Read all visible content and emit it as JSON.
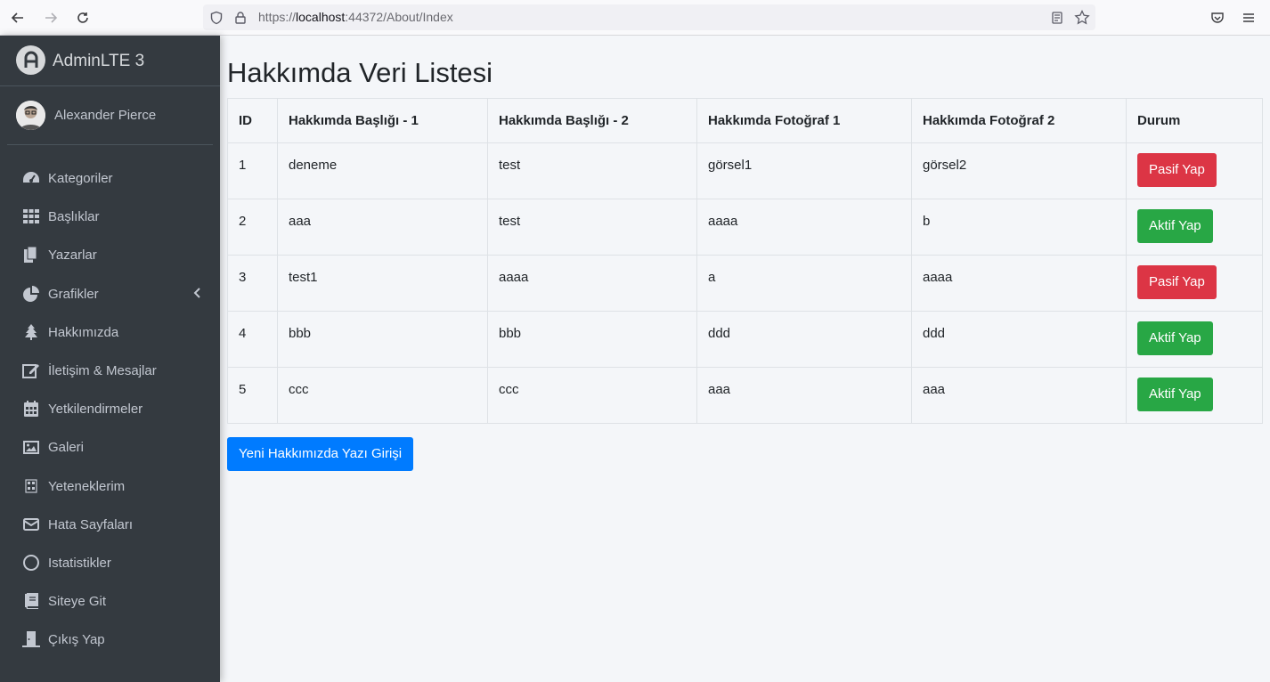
{
  "browser": {
    "url_prefix": "https://",
    "url_host": "localhost",
    "url_rest": ":44372/About/Index"
  },
  "sidebar": {
    "brand": "AdminLTE 3",
    "user": "Alexander Pierce",
    "items": [
      {
        "label": "Kategoriler",
        "icon": "dashboard-gauge-icon"
      },
      {
        "label": "Başlıklar",
        "icon": "grid-icon"
      },
      {
        "label": "Yazarlar",
        "icon": "copy-icon"
      },
      {
        "label": "Grafikler",
        "icon": "pie-chart-icon"
      },
      {
        "label": "Hakkımızda",
        "icon": "tree-icon"
      },
      {
        "label": "İletişim & Mesajlar",
        "icon": "edit-icon"
      },
      {
        "label": "Yetkilendirmeler",
        "icon": "calendar-icon"
      },
      {
        "label": "Galeri",
        "icon": "image-icon"
      },
      {
        "label": "Yeteneklerim",
        "icon": "keyboard-icon"
      },
      {
        "label": "Hata Sayfaları",
        "icon": "envelope-icon"
      },
      {
        "label": "Istatistikler",
        "icon": "circle-icon"
      },
      {
        "label": "Siteye Git",
        "icon": "book-icon"
      },
      {
        "label": "Çıkış Yap",
        "icon": "door-icon"
      }
    ]
  },
  "main": {
    "title": "Hakkımda Veri Listesi",
    "columns": [
      "ID",
      "Hakkımda Başlığı - 1",
      "Hakkımda Başlığı - 2",
      "Hakkımda Fotoğraf 1",
      "Hakkımda Fotoğraf 2",
      "Durum"
    ],
    "rows": [
      {
        "id": "1",
        "c1": "deneme",
        "c2": "test",
        "c3": "görsel1",
        "c4": "görsel2",
        "action": "Pasif Yap"
      },
      {
        "id": "2",
        "c1": "aaa",
        "c2": "test",
        "c3": "aaaa",
        "c4": "b",
        "action": "Aktif Yap"
      },
      {
        "id": "3",
        "c1": "test1",
        "c2": "aaaa",
        "c3": "a",
        "c4": "aaaa",
        "action": "Pasif Yap"
      },
      {
        "id": "4",
        "c1": "bbb",
        "c2": "bbb",
        "c3": "ddd",
        "c4": "ddd",
        "action": "Aktif Yap"
      },
      {
        "id": "5",
        "c1": "ccc",
        "c2": "ccc",
        "c3": "aaa",
        "c4": "aaa",
        "action": "Aktif Yap"
      }
    ],
    "new_button": "Yeni Hakkımızda Yazı Girişi"
  },
  "colors": {
    "sidebar_bg": "#343a40",
    "danger": "#dc3545",
    "success": "#28a745",
    "primary": "#007bff"
  }
}
